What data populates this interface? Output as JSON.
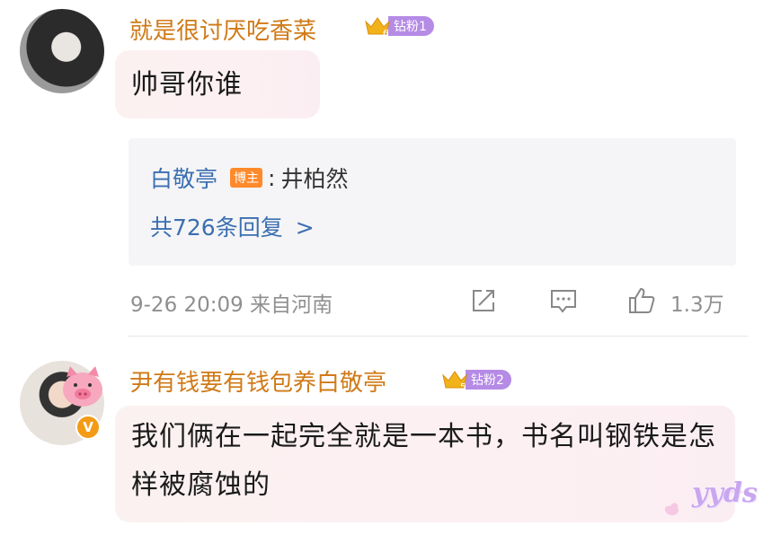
{
  "comments": [
    {
      "username": "就是很讨厌吃香菜",
      "badge_level": "6",
      "badge_text": "钻粉1",
      "text": "帅哥你谁",
      "reply": {
        "author": "白敬亭",
        "author_tag": "博主",
        "separator": ":",
        "text": "井柏然",
        "count_text": "共726条回复",
        "chevron": ">"
      },
      "meta": "9-26 20:09 来自河南",
      "like_count": "1.3万"
    },
    {
      "username": "尹有钱要有钱包养白敬亭",
      "badge_level": "5",
      "badge_text": "钻粉2",
      "verified": "V",
      "text": "我们俩在一起完全就是一本书，书名叫钢铁是怎样被腐蚀的"
    }
  ],
  "stickers": {
    "yyds": "yyds"
  },
  "colors": {
    "username": "#d07a17",
    "link": "#3b6fb0",
    "badge": "#b58be6",
    "blogger_tag": "#ff8a2b"
  }
}
